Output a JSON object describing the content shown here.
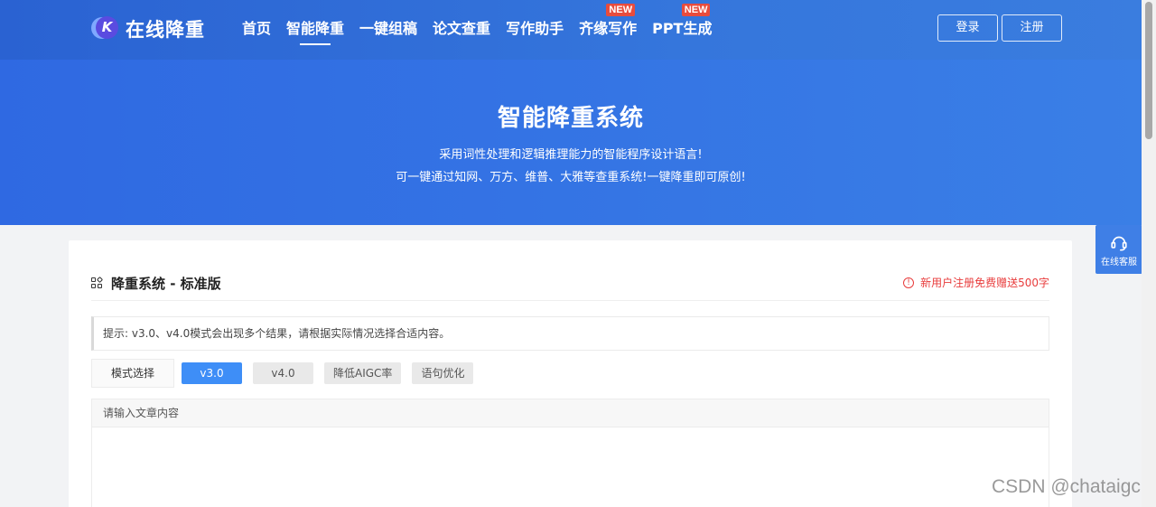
{
  "header": {
    "logo_letter": "K",
    "logo_text": "在线降重",
    "nav": [
      {
        "label": "首页",
        "badge": ""
      },
      {
        "label": "智能降重",
        "badge": "",
        "active": true
      },
      {
        "label": "一键组稿",
        "badge": ""
      },
      {
        "label": "论文查重",
        "badge": ""
      },
      {
        "label": "写作助手",
        "badge": ""
      },
      {
        "label": "齐缘写作",
        "badge": "NEW"
      },
      {
        "label": "PPT生成",
        "badge": "NEW"
      }
    ],
    "login_label": "登录",
    "register_label": "注册"
  },
  "hero": {
    "title": "智能降重系统",
    "line1": "采用词性处理和逻辑推理能力的智能程序设计语言!",
    "line2": "可一键通过知网、万方、维普、大雅等查重系统!一键降重即可原创!"
  },
  "card": {
    "title": "降重系统 - 标准版",
    "promo": "新用户注册免费赠送500字",
    "tip": "提示: v3.0、v4.0模式会出现多个结果，请根据实际情况选择合适内容。",
    "mode_label": "模式选择",
    "modes": [
      "v3.0",
      "v4.0",
      "降低AIGC率",
      "语句优化"
    ],
    "editor_label": "请输入文章内容"
  },
  "service": {
    "label": "在线客服"
  },
  "watermark": "CSDN @chataigc",
  "colors": {
    "primary": "#3576dc",
    "active_mode": "#3e8ef7",
    "badge": "#e84c3d",
    "promo": "#e83c3c"
  }
}
